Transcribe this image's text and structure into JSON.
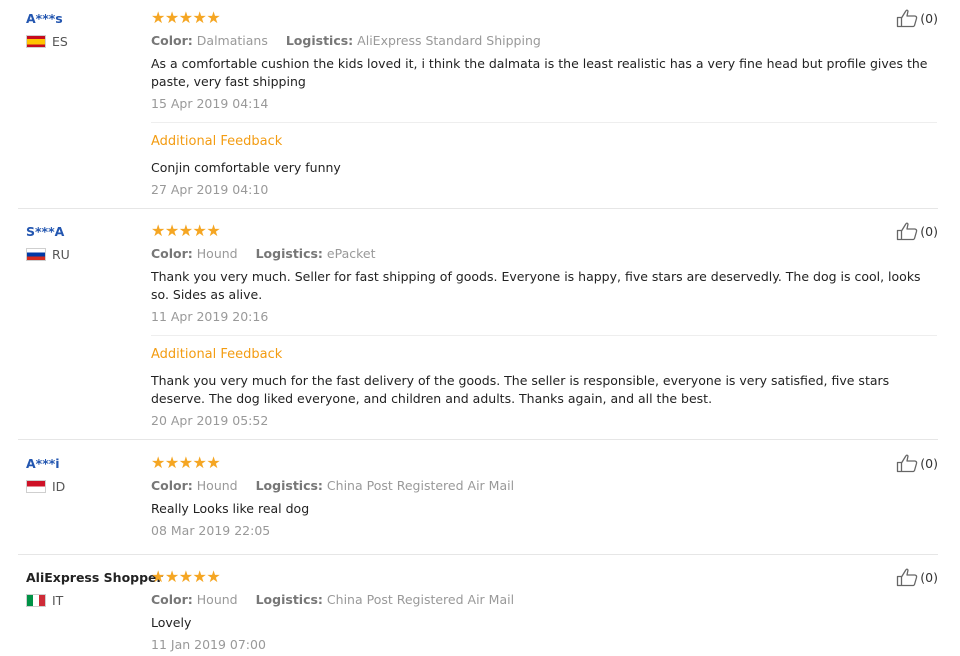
{
  "reviews": [
    {
      "user": "A***s",
      "country": "ES",
      "color_label": "Color:",
      "color": "Dalmatians",
      "logistics_label": "Logistics:",
      "logistics": "AliExpress Standard Shipping",
      "text": "As a comfortable cushion the kids loved it, i think the dalmata is the least realistic has a very fine head but profile gives the paste, very fast shipping",
      "date": "15 Apr 2019 04:14",
      "additional_title": "Additional Feedback",
      "additional_text": "Conjin comfortable very funny",
      "additional_date": "27 Apr 2019 04:10",
      "helpful": "(0)",
      "rating": 5
    },
    {
      "user": "S***A",
      "country": "RU",
      "color_label": "Color:",
      "color": "Hound",
      "logistics_label": "Logistics:",
      "logistics": "ePacket",
      "text": "Thank you very much. Seller for fast shipping of goods. Everyone is happy, five stars are deservedly. The dog is cool, looks so. Sides as alive.",
      "date": "11 Apr 2019 20:16",
      "additional_title": "Additional Feedback",
      "additional_text": "Thank you very much for the fast delivery of the goods. The seller is responsible, everyone is very satisfied, five stars deserve. The dog liked everyone, and children and adults. Thanks again, and all the best.",
      "additional_date": "20 Apr 2019 05:52",
      "helpful": "(0)",
      "rating": 5
    },
    {
      "user": "A***i",
      "country": "ID",
      "color_label": "Color:",
      "color": "Hound",
      "logistics_label": "Logistics:",
      "logistics": "China Post Registered Air Mail",
      "text": "Really Looks like real dog",
      "date": "08 Mar 2019 22:05",
      "helpful": "(0)",
      "rating": 5
    },
    {
      "user": "AliExpress Shopper",
      "country": "IT",
      "color_label": "Color:",
      "color": "Hound",
      "logistics_label": "Logistics:",
      "logistics": "China Post Registered Air Mail",
      "text": "Lovely",
      "date": "11 Jan 2019 07:00",
      "helpful": "(0)",
      "rating": 5
    }
  ],
  "colors": {
    "user_link": "#2356b0",
    "stars": "#f5a623",
    "additional_title": "#f39c12",
    "muted": "#999999"
  },
  "icons": {
    "star": "star-icon",
    "helpful": "thumbs-up-icon"
  }
}
